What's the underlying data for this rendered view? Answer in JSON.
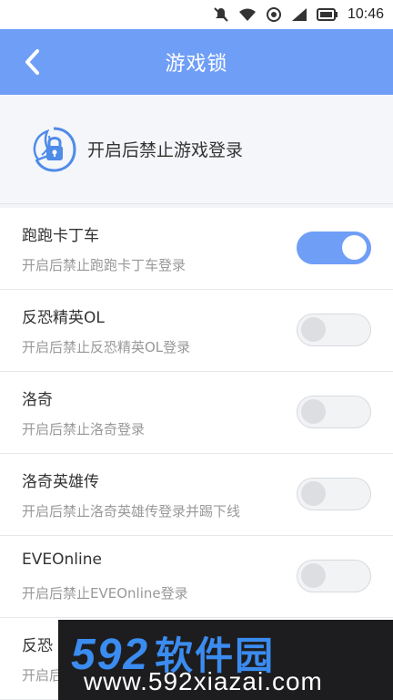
{
  "status_bar": {
    "time": "10:46",
    "icons": [
      "notification-off-icon",
      "wifi-icon",
      "sync-icon",
      "signal-icon",
      "battery-icon"
    ]
  },
  "header": {
    "title": "游戏锁",
    "back_icon": "chevron-left-icon"
  },
  "intro": {
    "icon": "shield-lock-icon",
    "text": "开启后禁止游戏登录"
  },
  "games": [
    {
      "name": "跑跑卡丁车",
      "desc": "开启后禁止跑跑卡丁车登录",
      "enabled": true
    },
    {
      "name": "反恐精英OL",
      "desc": "开启后禁止反恐精英OL登录",
      "enabled": false
    },
    {
      "name": "洛奇",
      "desc": "开启后禁止洛奇登录",
      "enabled": false
    },
    {
      "name": "洛奇英雄传",
      "desc": "开启后禁止洛奇英雄传登录并踢下线",
      "enabled": false
    },
    {
      "name": "EVEOnline",
      "desc": "开启后禁止EVEOnline登录",
      "enabled": false
    },
    {
      "name": "反恐",
      "desc": "开启后",
      "enabled": false
    }
  ],
  "watermark": {
    "logo_number": "592",
    "logo_text": "软件园",
    "url": "www.592xiazai.com"
  },
  "colors": {
    "accent": "#6f9ef7",
    "toggle_off": "#f2f3f5",
    "watermark_blue": "#3b8cf0"
  }
}
